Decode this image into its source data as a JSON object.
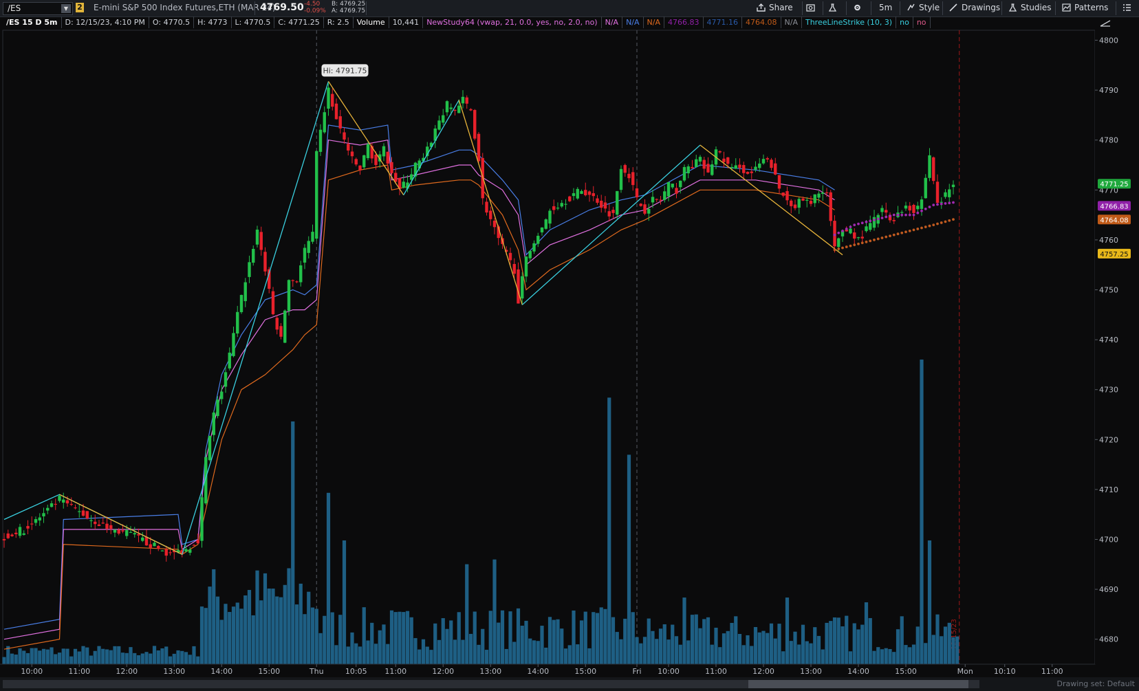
{
  "toolbar": {
    "symbol": "/ES",
    "link_badge": "2",
    "description": "E-mini S&P 500 Index Futures,ETH (MAR 24)",
    "last": "4769.50",
    "net_change": "-4.50",
    "pct_change": "-0.09%",
    "bid": "B: 4769.25",
    "ask": "A: 4769.75",
    "share_label": "Share",
    "timeframe_label": "5m",
    "style_label": "Style",
    "drawings_label": "Drawings",
    "studies_label": "Studies",
    "patterns_label": "Patterns"
  },
  "infobar": {
    "symbol_tf": "/ES 15 D 5m",
    "date": "D: 12/15/23, 4:10 PM",
    "open": "O: 4770.5",
    "high": "H: 4773",
    "low": "L: 4770.5",
    "close": "C: 4771.25",
    "range": "R: 2.5",
    "volume_label": "Volume",
    "volume_value": "10,441",
    "study1": "NewStudy64 (vwap, 21, 0.0, yes, no, 2.0, no)",
    "s1_v1": "N/A",
    "s1_v2": "N/A",
    "s1_v3": "N/A",
    "s1_v4": "4766.83",
    "s1_v5": "4771.16",
    "s1_v6": "4764.08",
    "s1_v7": "N/A",
    "study2": "ThreeLineStrike (10, 3)",
    "s2_v1": "no",
    "s2_v2": "no"
  },
  "footer": {
    "drawing_set": "Drawing set: Default"
  },
  "colors": {
    "background": "#0b0b0c",
    "up": "#22c04a",
    "down": "#e8212b",
    "volume": "#1e5f84",
    "zigzag_up": "#3ad0e0",
    "zigzag_down": "#e8b43a",
    "band_upper": "#4a7fe8",
    "band_mid": "#e070e0",
    "band_lower": "#e06a1e",
    "vwap_dot": "#a02ab0",
    "lower_dot": "#c05a20"
  },
  "chart_data": {
    "type": "candlestick",
    "ylim": [
      4675,
      4802
    ],
    "y_ticks": [
      4680,
      4690,
      4700,
      4710,
      4720,
      4730,
      4740,
      4750,
      4760,
      4770,
      4780,
      4790,
      4800
    ],
    "x_labels": [
      "10:00",
      "11:00",
      "12:00",
      "13:00",
      "14:00",
      "15:00",
      "Thu",
      "10:05",
      "11:00",
      "12:00",
      "13:00",
      "14:00",
      "15:00",
      "Fri",
      "10:00",
      "11:00",
      "12:00",
      "13:00",
      "14:00",
      "15:00",
      "Mon",
      "10:10",
      "11:00"
    ],
    "x_label_index": [
      7,
      19,
      31,
      43,
      55,
      67,
      79,
      89,
      99,
      111,
      123,
      135,
      147,
      160,
      168,
      180,
      192,
      204,
      216,
      228,
      243,
      253,
      265
    ],
    "day_separators": [
      79,
      160
    ],
    "current_bar_index": 241,
    "price_tags": [
      {
        "label": "4771.25",
        "value": 4771.25,
        "bg": "#1fa83c",
        "fg": "#ffffff"
      },
      {
        "label": "4766.83",
        "value": 4766.83,
        "bg": "#9020a8",
        "fg": "#ffffff"
      },
      {
        "label": "4764.08",
        "value": 4764.08,
        "bg": "#c05a18",
        "fg": "#ffffff"
      },
      {
        "label": "4757.25",
        "value": 4757.25,
        "bg": "#e8b81a",
        "fg": "#111111"
      }
    ],
    "annotation": {
      "label": "Hi: 4791.75",
      "value": 4791.75,
      "index": 82
    },
    "current_date_label": "12/15/23",
    "close_path": [
      [
        0,
        4700.5
      ],
      [
        5,
        4702
      ],
      [
        10,
        4705
      ],
      [
        14,
        4708
      ],
      [
        16,
        4707
      ],
      [
        22,
        4704
      ],
      [
        27,
        4702
      ],
      [
        32,
        4701
      ],
      [
        37,
        4699
      ],
      [
        42,
        4697
      ],
      [
        46,
        4698
      ],
      [
        49,
        4700
      ],
      [
        51,
        4716
      ],
      [
        53,
        4725
      ],
      [
        55,
        4730
      ],
      [
        57,
        4737
      ],
      [
        59,
        4745
      ],
      [
        61,
        4752
      ],
      [
        64,
        4762
      ],
      [
        66,
        4754
      ],
      [
        68,
        4745
      ],
      [
        70,
        4740
      ],
      [
        72,
        4752
      ],
      [
        74,
        4752
      ],
      [
        76,
        4758
      ],
      [
        78,
        4761
      ],
      [
        79,
        4777
      ],
      [
        81,
        4786
      ],
      [
        82,
        4790
      ],
      [
        84,
        4784
      ],
      [
        86,
        4780
      ],
      [
        88,
        4776
      ],
      [
        90,
        4774
      ],
      [
        92,
        4779
      ],
      [
        94,
        4775
      ],
      [
        96,
        4778
      ],
      [
        98,
        4774
      ],
      [
        100,
        4770
      ],
      [
        102,
        4772
      ],
      [
        104,
        4775
      ],
      [
        106,
        4776
      ],
      [
        108,
        4780
      ],
      [
        110,
        4784
      ],
      [
        112,
        4787
      ],
      [
        114,
        4786
      ],
      [
        116,
        4788
      ],
      [
        118,
        4786
      ],
      [
        120,
        4776
      ],
      [
        121,
        4768
      ],
      [
        123,
        4764
      ],
      [
        125,
        4760
      ],
      [
        127,
        4757
      ],
      [
        129,
        4754
      ],
      [
        130,
        4748
      ],
      [
        132,
        4756
      ],
      [
        134,
        4760
      ],
      [
        136,
        4762
      ],
      [
        138,
        4766
      ],
      [
        140,
        4767
      ],
      [
        142,
        4768
      ],
      [
        144,
        4769
      ],
      [
        146,
        4770
      ],
      [
        148,
        4769
      ],
      [
        150,
        4768
      ],
      [
        152,
        4766
      ],
      [
        154,
        4765
      ],
      [
        156,
        4775
      ],
      [
        158,
        4773
      ],
      [
        160,
        4768
      ],
      [
        162,
        4766
      ],
      [
        164,
        4768
      ],
      [
        166,
        4768
      ],
      [
        168,
        4771
      ],
      [
        170,
        4770
      ],
      [
        172,
        4774
      ],
      [
        174,
        4775
      ],
      [
        176,
        4776
      ],
      [
        178,
        4773
      ],
      [
        180,
        4778
      ],
      [
        182,
        4776
      ],
      [
        184,
        4774
      ],
      [
        186,
        4775
      ],
      [
        188,
        4773
      ],
      [
        190,
        4774
      ],
      [
        192,
        4776
      ],
      [
        194,
        4775
      ],
      [
        196,
        4770
      ],
      [
        198,
        4768
      ],
      [
        200,
        4767
      ],
      [
        202,
        4768
      ],
      [
        204,
        4767
      ],
      [
        206,
        4770
      ],
      [
        208,
        4769
      ],
      [
        210,
        4758
      ],
      [
        212,
        4762
      ],
      [
        214,
        4762
      ],
      [
        216,
        4760
      ],
      [
        218,
        4762
      ],
      [
        220,
        4764
      ],
      [
        222,
        4766
      ],
      [
        224,
        4764
      ],
      [
        226,
        4765
      ],
      [
        228,
        4767
      ],
      [
        230,
        4766
      ],
      [
        232,
        4768
      ],
      [
        234,
        4777
      ],
      [
        236,
        4767
      ],
      [
        238,
        4769
      ],
      [
        240,
        4771.25
      ]
    ],
    "zigzag": [
      {
        "color": "cyan",
        "points": [
          [
            0,
            4704
          ],
          [
            14,
            4709
          ],
          [
            45,
            4697
          ],
          [
            82,
            4791.75
          ]
        ]
      },
      {
        "color": "orange",
        "points": [
          [
            14,
            4709
          ],
          [
            45,
            4697
          ]
        ]
      },
      {
        "color": "orange",
        "points": [
          [
            82,
            4791.75
          ],
          [
            101,
            4769
          ]
        ]
      },
      {
        "color": "cyan",
        "points": [
          [
            101,
            4769
          ],
          [
            115,
            4788
          ]
        ]
      },
      {
        "color": "orange",
        "points": [
          [
            115,
            4788
          ],
          [
            131,
            4747
          ]
        ]
      },
      {
        "color": "cyan",
        "points": [
          [
            131,
            4747
          ],
          [
            176,
            4779
          ]
        ]
      },
      {
        "color": "orange",
        "points": [
          [
            176,
            4779
          ],
          [
            212,
            4757
          ]
        ]
      }
    ],
    "bands": [
      {
        "color": "band_upper",
        "points": [
          [
            0,
            4682
          ],
          [
            14,
            4684
          ],
          [
            15,
            4704
          ],
          [
            44,
            4705
          ],
          [
            45,
            4699
          ],
          [
            49,
            4700
          ],
          [
            51,
            4718
          ],
          [
            55,
            4733
          ],
          [
            60,
            4741
          ],
          [
            66,
            4748
          ],
          [
            73,
            4750
          ],
          [
            76,
            4749
          ],
          [
            79,
            4751
          ],
          [
            82,
            4783
          ],
          [
            90,
            4782
          ],
          [
            97,
            4783
          ],
          [
            98,
            4774
          ],
          [
            104,
            4775
          ],
          [
            115,
            4778
          ],
          [
            118,
            4778
          ],
          [
            120,
            4777
          ],
          [
            126,
            4772
          ],
          [
            130,
            4768
          ],
          [
            132,
            4757
          ],
          [
            138,
            4762
          ],
          [
            148,
            4766
          ],
          [
            156,
            4768
          ],
          [
            162,
            4769
          ],
          [
            176,
            4775
          ],
          [
            190,
            4774
          ],
          [
            206,
            4772
          ],
          [
            210,
            4770
          ]
        ]
      },
      {
        "color": "band_mid",
        "points": [
          [
            0,
            4680
          ],
          [
            14,
            4682
          ],
          [
            15,
            4702
          ],
          [
            44,
            4702
          ],
          [
            45,
            4698
          ],
          [
            49,
            4700
          ],
          [
            51,
            4716
          ],
          [
            55,
            4730
          ],
          [
            60,
            4737
          ],
          [
            66,
            4744
          ],
          [
            73,
            4746
          ],
          [
            76,
            4746
          ],
          [
            79,
            4748
          ],
          [
            82,
            4780
          ],
          [
            90,
            4779
          ],
          [
            97,
            4780
          ],
          [
            98,
            4772
          ],
          [
            104,
            4773
          ],
          [
            115,
            4775
          ],
          [
            118,
            4775
          ],
          [
            120,
            4773
          ],
          [
            126,
            4770
          ],
          [
            130,
            4765
          ],
          [
            132,
            4755
          ],
          [
            138,
            4759
          ],
          [
            148,
            4762
          ],
          [
            156,
            4765
          ],
          [
            162,
            4766
          ],
          [
            176,
            4772
          ],
          [
            190,
            4772
          ],
          [
            206,
            4770
          ],
          [
            210,
            4768
          ]
        ]
      },
      {
        "color": "band_lower",
        "points": [
          [
            0,
            4678
          ],
          [
            14,
            4680
          ],
          [
            15,
            4699
          ],
          [
            44,
            4698
          ],
          [
            45,
            4697
          ],
          [
            49,
            4699
          ],
          [
            51,
            4706
          ],
          [
            55,
            4720
          ],
          [
            60,
            4730
          ],
          [
            66,
            4733
          ],
          [
            73,
            4738
          ],
          [
            76,
            4741
          ],
          [
            79,
            4743
          ],
          [
            82,
            4772
          ],
          [
            90,
            4774
          ],
          [
            97,
            4775
          ],
          [
            98,
            4770
          ],
          [
            104,
            4771
          ],
          [
            115,
            4772
          ],
          [
            118,
            4772
          ],
          [
            120,
            4771
          ],
          [
            126,
            4765
          ],
          [
            130,
            4758
          ],
          [
            132,
            4750
          ],
          [
            138,
            4754
          ],
          [
            148,
            4758
          ],
          [
            156,
            4762
          ],
          [
            162,
            4764
          ],
          [
            176,
            4770
          ],
          [
            190,
            4770
          ],
          [
            206,
            4768
          ],
          [
            210,
            4766
          ]
        ]
      }
    ],
    "dots_upper": [
      [
        210,
        4761
      ],
      [
        215,
        4763
      ],
      [
        220,
        4764
      ],
      [
        225,
        4765
      ],
      [
        230,
        4765
      ],
      [
        235,
        4767
      ],
      [
        240,
        4767.5
      ]
    ],
    "dots_lower": [
      [
        210,
        4758
      ],
      [
        215,
        4759
      ],
      [
        220,
        4760
      ],
      [
        225,
        4761
      ],
      [
        230,
        4762
      ],
      [
        235,
        4763
      ],
      [
        240,
        4764.1
      ]
    ],
    "volume_ylim": [
      0,
      65000
    ],
    "volume_spikes": [
      [
        73,
        51000
      ],
      [
        82,
        36000
      ],
      [
        86,
        26000
      ],
      [
        117,
        21000
      ],
      [
        124,
        22000
      ],
      [
        153,
        56000
      ],
      [
        158,
        44000
      ],
      [
        172,
        14000
      ],
      [
        198,
        14000
      ],
      [
        218,
        13000
      ],
      [
        232,
        64000
      ],
      [
        234,
        26000
      ]
    ]
  }
}
